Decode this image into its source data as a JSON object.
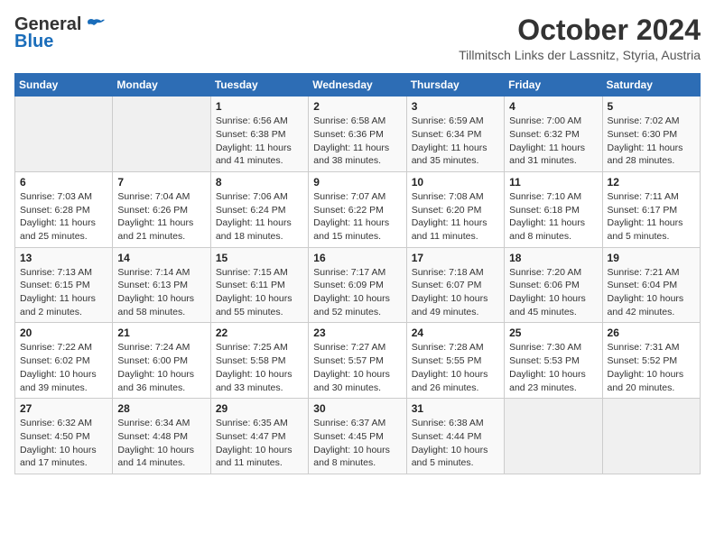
{
  "header": {
    "logo_general": "General",
    "logo_blue": "Blue",
    "month": "October 2024",
    "location": "Tillmitsch Links der Lassnitz, Styria, Austria"
  },
  "days_of_week": [
    "Sunday",
    "Monday",
    "Tuesday",
    "Wednesday",
    "Thursday",
    "Friday",
    "Saturday"
  ],
  "weeks": [
    [
      {
        "day": "",
        "detail": ""
      },
      {
        "day": "",
        "detail": ""
      },
      {
        "day": "1",
        "detail": "Sunrise: 6:56 AM\nSunset: 6:38 PM\nDaylight: 11 hours and 41 minutes."
      },
      {
        "day": "2",
        "detail": "Sunrise: 6:58 AM\nSunset: 6:36 PM\nDaylight: 11 hours and 38 minutes."
      },
      {
        "day": "3",
        "detail": "Sunrise: 6:59 AM\nSunset: 6:34 PM\nDaylight: 11 hours and 35 minutes."
      },
      {
        "day": "4",
        "detail": "Sunrise: 7:00 AM\nSunset: 6:32 PM\nDaylight: 11 hours and 31 minutes."
      },
      {
        "day": "5",
        "detail": "Sunrise: 7:02 AM\nSunset: 6:30 PM\nDaylight: 11 hours and 28 minutes."
      }
    ],
    [
      {
        "day": "6",
        "detail": "Sunrise: 7:03 AM\nSunset: 6:28 PM\nDaylight: 11 hours and 25 minutes."
      },
      {
        "day": "7",
        "detail": "Sunrise: 7:04 AM\nSunset: 6:26 PM\nDaylight: 11 hours and 21 minutes."
      },
      {
        "day": "8",
        "detail": "Sunrise: 7:06 AM\nSunset: 6:24 PM\nDaylight: 11 hours and 18 minutes."
      },
      {
        "day": "9",
        "detail": "Sunrise: 7:07 AM\nSunset: 6:22 PM\nDaylight: 11 hours and 15 minutes."
      },
      {
        "day": "10",
        "detail": "Sunrise: 7:08 AM\nSunset: 6:20 PM\nDaylight: 11 hours and 11 minutes."
      },
      {
        "day": "11",
        "detail": "Sunrise: 7:10 AM\nSunset: 6:18 PM\nDaylight: 11 hours and 8 minutes."
      },
      {
        "day": "12",
        "detail": "Sunrise: 7:11 AM\nSunset: 6:17 PM\nDaylight: 11 hours and 5 minutes."
      }
    ],
    [
      {
        "day": "13",
        "detail": "Sunrise: 7:13 AM\nSunset: 6:15 PM\nDaylight: 11 hours and 2 minutes."
      },
      {
        "day": "14",
        "detail": "Sunrise: 7:14 AM\nSunset: 6:13 PM\nDaylight: 10 hours and 58 minutes."
      },
      {
        "day": "15",
        "detail": "Sunrise: 7:15 AM\nSunset: 6:11 PM\nDaylight: 10 hours and 55 minutes."
      },
      {
        "day": "16",
        "detail": "Sunrise: 7:17 AM\nSunset: 6:09 PM\nDaylight: 10 hours and 52 minutes."
      },
      {
        "day": "17",
        "detail": "Sunrise: 7:18 AM\nSunset: 6:07 PM\nDaylight: 10 hours and 49 minutes."
      },
      {
        "day": "18",
        "detail": "Sunrise: 7:20 AM\nSunset: 6:06 PM\nDaylight: 10 hours and 45 minutes."
      },
      {
        "day": "19",
        "detail": "Sunrise: 7:21 AM\nSunset: 6:04 PM\nDaylight: 10 hours and 42 minutes."
      }
    ],
    [
      {
        "day": "20",
        "detail": "Sunrise: 7:22 AM\nSunset: 6:02 PM\nDaylight: 10 hours and 39 minutes."
      },
      {
        "day": "21",
        "detail": "Sunrise: 7:24 AM\nSunset: 6:00 PM\nDaylight: 10 hours and 36 minutes."
      },
      {
        "day": "22",
        "detail": "Sunrise: 7:25 AM\nSunset: 5:58 PM\nDaylight: 10 hours and 33 minutes."
      },
      {
        "day": "23",
        "detail": "Sunrise: 7:27 AM\nSunset: 5:57 PM\nDaylight: 10 hours and 30 minutes."
      },
      {
        "day": "24",
        "detail": "Sunrise: 7:28 AM\nSunset: 5:55 PM\nDaylight: 10 hours and 26 minutes."
      },
      {
        "day": "25",
        "detail": "Sunrise: 7:30 AM\nSunset: 5:53 PM\nDaylight: 10 hours and 23 minutes."
      },
      {
        "day": "26",
        "detail": "Sunrise: 7:31 AM\nSunset: 5:52 PM\nDaylight: 10 hours and 20 minutes."
      }
    ],
    [
      {
        "day": "27",
        "detail": "Sunrise: 6:32 AM\nSunset: 4:50 PM\nDaylight: 10 hours and 17 minutes."
      },
      {
        "day": "28",
        "detail": "Sunrise: 6:34 AM\nSunset: 4:48 PM\nDaylight: 10 hours and 14 minutes."
      },
      {
        "day": "29",
        "detail": "Sunrise: 6:35 AM\nSunset: 4:47 PM\nDaylight: 10 hours and 11 minutes."
      },
      {
        "day": "30",
        "detail": "Sunrise: 6:37 AM\nSunset: 4:45 PM\nDaylight: 10 hours and 8 minutes."
      },
      {
        "day": "31",
        "detail": "Sunrise: 6:38 AM\nSunset: 4:44 PM\nDaylight: 10 hours and 5 minutes."
      },
      {
        "day": "",
        "detail": ""
      },
      {
        "day": "",
        "detail": ""
      }
    ]
  ]
}
